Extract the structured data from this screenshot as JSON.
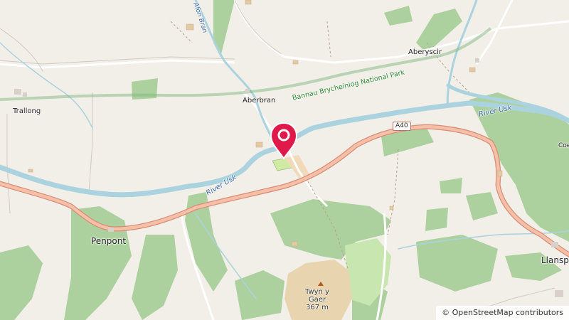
{
  "map": {
    "places": {
      "trallong": "Trallong",
      "aberbran": "Aberbran",
      "aberyscir": "Aberyscir",
      "penpont": "Penpont",
      "llanspyddid": "Llansp",
      "coed": "Coe"
    },
    "water": {
      "river_usk_1": "River Usk",
      "river_usk_2": "River Usk",
      "afon_bran": "Afon Bran"
    },
    "park_name": "Bannau Brycheiniog National Park",
    "road_ref": "A40",
    "peak": {
      "name_line1": "Twyn y",
      "name_line2": "Gaer",
      "elevation": "367 m"
    },
    "marker": {
      "name": "location-marker",
      "color": "#e0194b"
    },
    "attribution": "© OpenStreetMap contributors",
    "colors": {
      "background": "#f2efe9",
      "woodland": "#add19e",
      "water": "#aad3df",
      "road": "#f6bfa8",
      "road_casing": "#d88e78",
      "park_boundary": "#7fb77f"
    }
  }
}
